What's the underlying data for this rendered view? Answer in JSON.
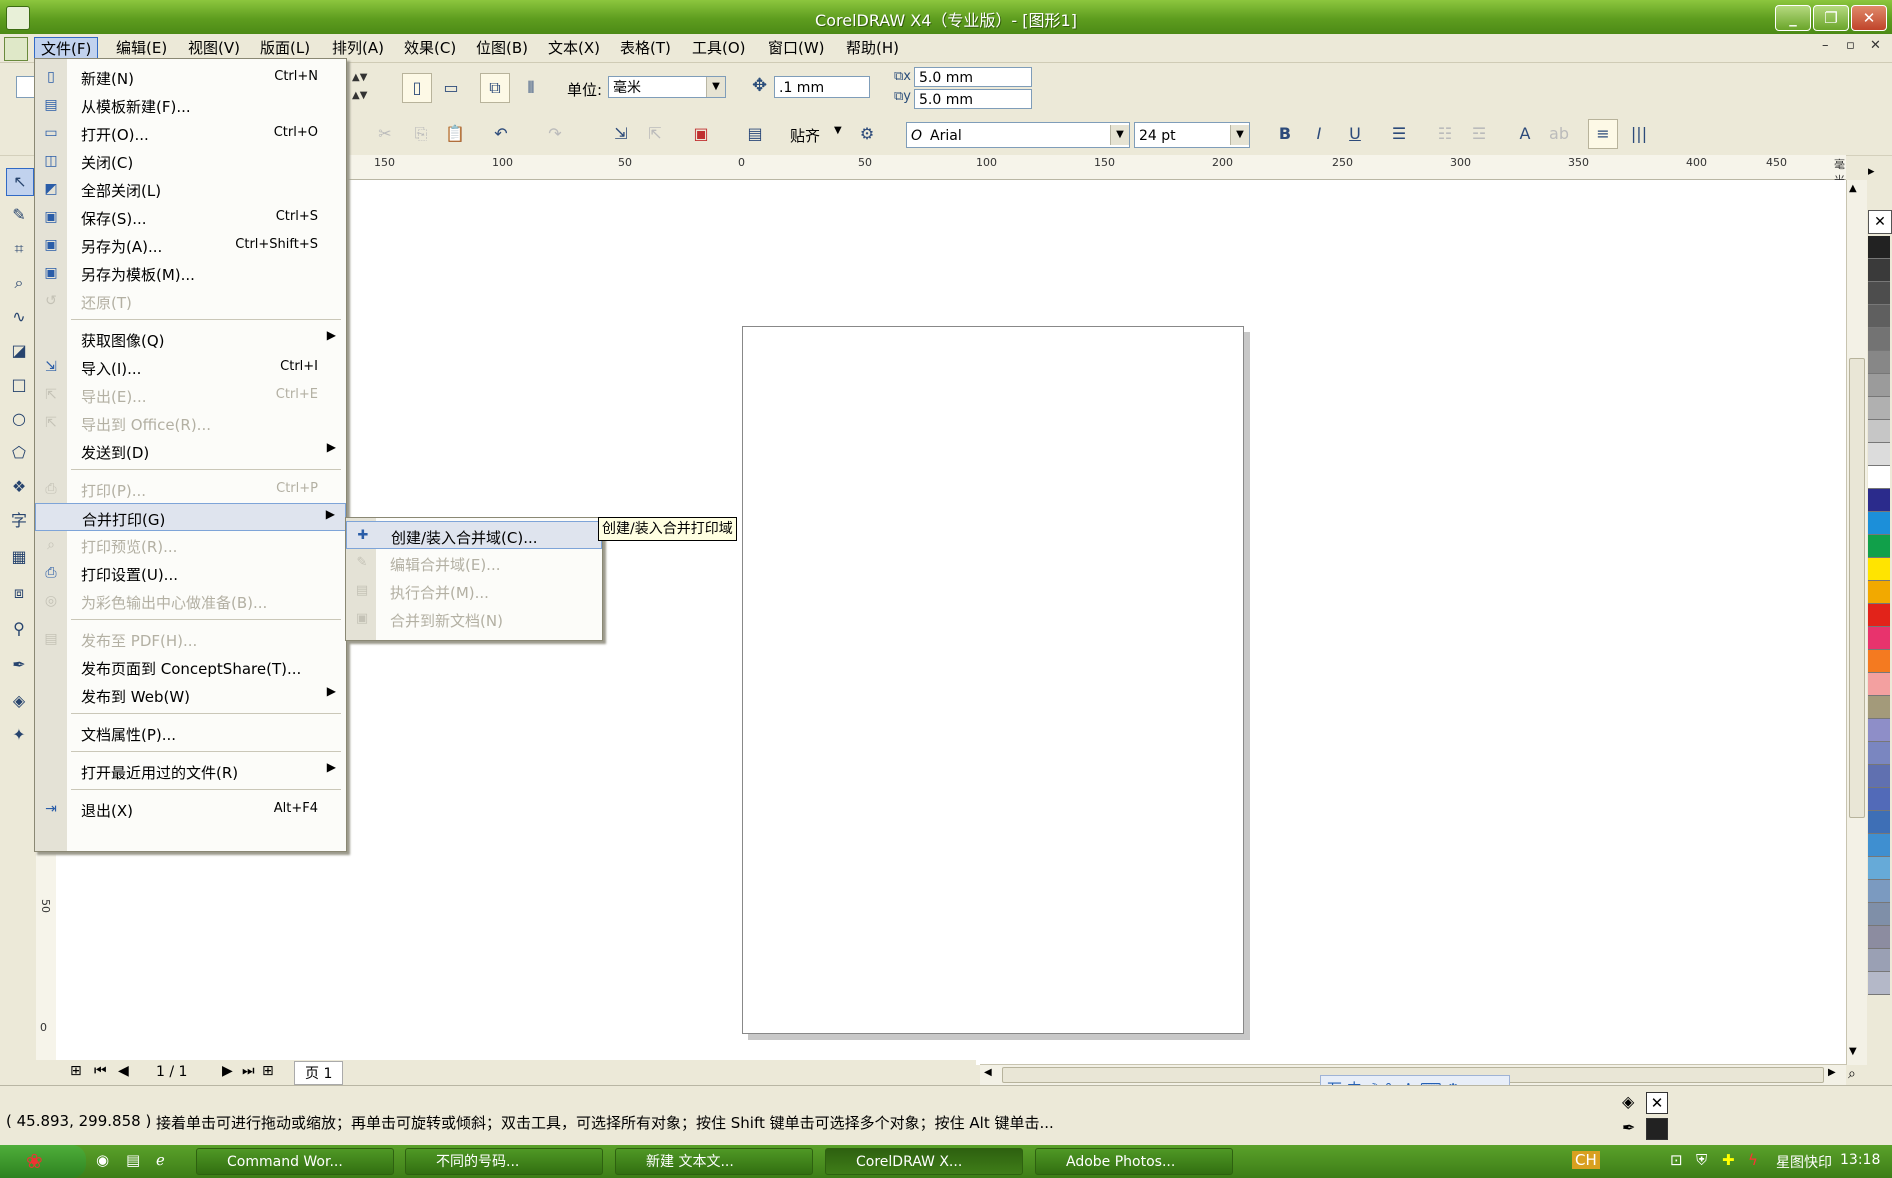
{
  "window": {
    "title": "CorelDRAW X4（专业版）- [图形1]"
  },
  "menubar": {
    "items": [
      "文件(F)",
      "编辑(E)",
      "视图(V)",
      "版面(L)",
      "排列(A)",
      "效果(C)",
      "位图(B)",
      "文本(X)",
      "表格(T)",
      "工具(O)",
      "窗口(W)",
      "帮助(H)"
    ]
  },
  "toolbar": {
    "unit_label": "单位:",
    "unit_value": "毫米",
    "nudge_value": ".1 mm",
    "dup_x": "5.0 mm",
    "dup_y": "5.0 mm",
    "snap_label": "贴齐",
    "font_name": "Arial",
    "font_size": "24 pt"
  },
  "file_menu": {
    "items": [
      {
        "label": "新建(N)",
        "shortcut": "Ctrl+N",
        "icon": "new-document-icon"
      },
      {
        "label": "从模板新建(F)...",
        "shortcut": "",
        "icon": "template-icon"
      },
      {
        "label": "打开(O)...",
        "shortcut": "Ctrl+O",
        "icon": "open-folder-icon"
      },
      {
        "label": "关闭(C)",
        "shortcut": "",
        "icon": "close-document-icon"
      },
      {
        "label": "全部关闭(L)",
        "shortcut": "",
        "icon": "close-all-icon"
      },
      {
        "label": "保存(S)...",
        "shortcut": "Ctrl+S",
        "icon": "save-icon"
      },
      {
        "label": "另存为(A)...",
        "shortcut": "Ctrl+Shift+S",
        "icon": "save-as-icon"
      },
      {
        "label": "另存为模板(M)...",
        "shortcut": "",
        "icon": "save-template-icon"
      },
      {
        "label": "还原(T)",
        "shortcut": "",
        "icon": "revert-icon"
      },
      {
        "label": "获取图像(Q)",
        "shortcut": "",
        "icon": ""
      },
      {
        "label": "导入(I)...",
        "shortcut": "Ctrl+I",
        "icon": "import-icon"
      },
      {
        "label": "导出(E)...",
        "shortcut": "Ctrl+E",
        "icon": "export-icon"
      },
      {
        "label": "导出到 Office(R)...",
        "shortcut": "",
        "icon": "export-office-icon"
      },
      {
        "label": "发送到(D)",
        "shortcut": "",
        "icon": ""
      },
      {
        "label": "打印(P)...",
        "shortcut": "Ctrl+P",
        "icon": "print-icon"
      },
      {
        "label": "合并打印(G)",
        "shortcut": "",
        "icon": ""
      },
      {
        "label": "打印预览(R)...",
        "shortcut": "",
        "icon": "print-preview-icon"
      },
      {
        "label": "打印设置(U)...",
        "shortcut": "",
        "icon": "print-setup-icon"
      },
      {
        "label": "为彩色输出中心做准备(B)...",
        "shortcut": "",
        "icon": "color-output-icon"
      },
      {
        "label": "发布至 PDF(H)...",
        "shortcut": "",
        "icon": "pdf-icon"
      },
      {
        "label": "发布页面到 ConceptShare(T)...",
        "shortcut": "",
        "icon": ""
      },
      {
        "label": "发布到 Web(W)",
        "shortcut": "",
        "icon": ""
      },
      {
        "label": "文档属性(P)...",
        "shortcut": "",
        "icon": ""
      },
      {
        "label": "打开最近用过的文件(R)",
        "shortcut": "",
        "icon": ""
      },
      {
        "label": "退出(X)",
        "shortcut": "Alt+F4",
        "icon": "exit-icon"
      }
    ]
  },
  "merge_submenu": {
    "items": [
      {
        "label": "创建/装入合并域(C)..."
      },
      {
        "label": "编辑合并域(E)..."
      },
      {
        "label": "执行合并(M)..."
      },
      {
        "label": "合并到新文档(N)"
      }
    ],
    "tooltip": "创建/装入合并打印域"
  },
  "ruler": {
    "h_labels": [
      "150",
      "100",
      "50",
      "0",
      "50",
      "100",
      "150",
      "200",
      "250",
      "300",
      "350",
      "400",
      "450",
      "毫米"
    ],
    "v_labels": [
      "50",
      "0"
    ]
  },
  "pagenav": {
    "page_count": "1 / 1",
    "page_tab": "页 1"
  },
  "status": {
    "coords": "( 45.893, 299.858 )",
    "message": "接着单击可进行拖动或缩放；再单击可旋转或倾斜；双击工具，可选择所有对象；按住 Shift 键单击可选择多个对象；按住 Alt 键单击..."
  },
  "taskbar": {
    "tasks": [
      "Command Wor...",
      "不同的号码...",
      "新建 文本文...",
      "CorelDRAW X...",
      "Adobe Photos..."
    ],
    "tray_text": "星图快印",
    "clock": "13:18"
  },
  "palette": {
    "colors": [
      "#222222",
      "#3a3a3a",
      "#4d4d4d",
      "#5f5f5f",
      "#737373",
      "#878787",
      "#9b9b9b",
      "#b0b0b0",
      "#c6c6c6",
      "#dcdcdc",
      "#ffffff",
      "#2b2b8c",
      "#1c8fd9",
      "#11a04a",
      "#ffe400",
      "#f2a900",
      "#e2231a",
      "#e8336d",
      "#f47a20",
      "#f3a0a0",
      "#a39a7a",
      "#8e8ec8",
      "#7a86c0",
      "#6070b0",
      "#526ab8",
      "#3e6fb6",
      "#3f8fd0",
      "#66aad8",
      "#7b9ac0",
      "#7f8fa8",
      "#8c8ca0",
      "#9aa0b4",
      "#b4b8c8"
    ]
  }
}
